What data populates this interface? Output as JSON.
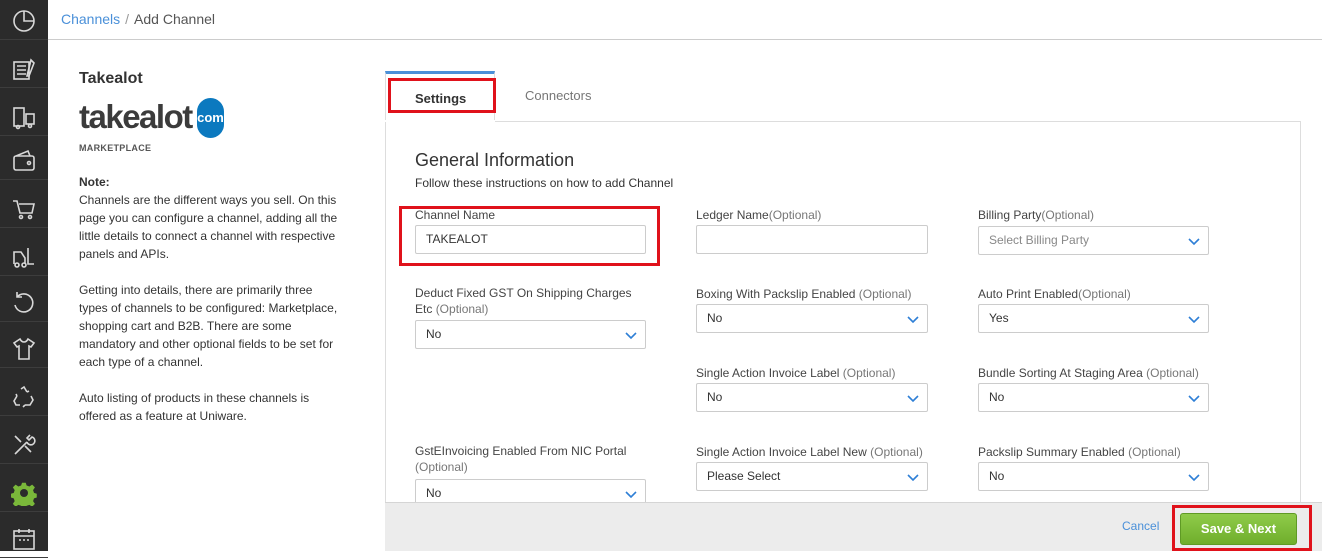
{
  "breadcrumb": {
    "parent": "Channels",
    "separator": "/",
    "current": "Add Channel"
  },
  "channel": {
    "name": "Takealot",
    "logo_word": "takealot",
    "logo_badge": "com",
    "type": "MARKETPLACE"
  },
  "note": {
    "label": "Note:",
    "paragraphs": [
      "Channels are the different ways you sell. On this page you can configure a channel, adding all the little details to connect a channel with respective panels and APIs.",
      "Getting into details, there are primarily three types of channels to be configured: Marketplace, shopping cart and B2B. There are some mandatory and other optional fields to be set for each type of a channel.",
      "Auto listing of products in these channels is offered as a feature at Uniware."
    ]
  },
  "tabs": {
    "settings": "Settings",
    "connectors": "Connectors"
  },
  "section": {
    "title": "General Information",
    "subtitle": "Follow these instructions on how to add Channel"
  },
  "fields": {
    "channel_name": {
      "label": "Channel Name",
      "value": "TAKEALOT"
    },
    "ledger_name": {
      "label": "Ledger Name",
      "optional": "(Optional)",
      "value": ""
    },
    "billing_party": {
      "label": "Billing Party",
      "optional": "(Optional)",
      "placeholder": "Select Billing Party"
    },
    "deduct_gst": {
      "label": "Deduct Fixed GST On Shipping Charges Etc",
      "optional": "(Optional)",
      "value": "No"
    },
    "boxing_packslip": {
      "label": "Boxing With Packslip Enabled",
      "optional": "(Optional)",
      "value": "No"
    },
    "auto_print": {
      "label": "Auto Print Enabled",
      "optional": "(Optional)",
      "value": "Yes"
    },
    "single_action_label": {
      "label": "Single Action Invoice Label",
      "optional": "(Optional)",
      "value": "No"
    },
    "bundle_sorting": {
      "label": "Bundle Sorting At Staging Area",
      "optional": "(Optional)",
      "value": "No"
    },
    "gst_einvoicing": {
      "label": "GstEInvoicing Enabled From NIC Portal",
      "optional": "(Optional)",
      "value": "No"
    },
    "single_action_label_new": {
      "label": "Single Action Invoice Label New",
      "optional": "(Optional)",
      "value": "Please Select"
    },
    "packslip_summary": {
      "label": "Packslip Summary Enabled",
      "optional": "(Optional)",
      "value": "No"
    }
  },
  "footer": {
    "cancel": "Cancel",
    "save": "Save & Next"
  },
  "colors": {
    "sidebar": "#2b2b2b",
    "link": "#4a90d9",
    "accent_green": "#7ab83a",
    "highlight_red": "#e0121b",
    "logo_blue": "#0b79bf"
  },
  "sidebar_icons": [
    "dashboard-icon",
    "orders-icon",
    "shipping-icon",
    "wallet-icon",
    "cart-icon",
    "forklift-icon",
    "returns-icon",
    "shirt-icon",
    "recycle-icon",
    "tools-icon",
    "settings-icon",
    "calendar-icon"
  ]
}
